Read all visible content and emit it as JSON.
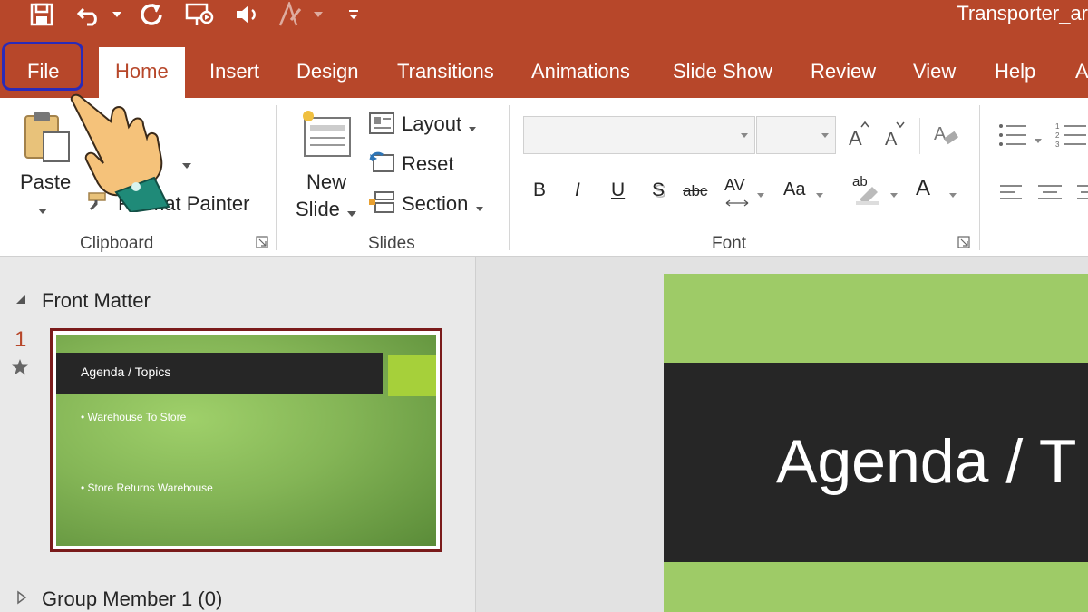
{
  "title_bar": {
    "document_title": "Transporter_ar"
  },
  "quick_access": [
    "save-icon",
    "undo-icon",
    "redo-icon",
    "present-icon",
    "speaker-icon",
    "format-icon",
    "customize-icon"
  ],
  "tabs": [
    "File",
    "Home",
    "Insert",
    "Design",
    "Transitions",
    "Animations",
    "Slide Show",
    "Review",
    "View",
    "Help",
    "A"
  ],
  "active_tab": "Home",
  "ribbon": {
    "clipboard": {
      "paste": "Paste",
      "format_painter": "Format Painter",
      "group_label": "Clipboard"
    },
    "slides": {
      "new_slide_1": "New",
      "new_slide_2": "Slide",
      "layout": "Layout",
      "reset": "Reset",
      "section": "Section",
      "group_label": "Slides"
    },
    "font": {
      "group_label": "Font",
      "font_name_value": "",
      "font_size_value": "",
      "bold": "B",
      "italic": "I",
      "underline": "U",
      "shadow": "S",
      "strike": "abc",
      "spacing": "AV",
      "case": "Aa",
      "highlight": "ab",
      "color": "A"
    }
  },
  "left_panel": {
    "section_1": "Front Matter",
    "slide_number": "1",
    "thumb_title": "Agenda / Topics",
    "thumb_bullets": [
      "• Warehouse To Store",
      "• Store Returns Warehouse"
    ],
    "section_2": "Group Member 1 (0)"
  },
  "main_slide": {
    "title": "Agenda / T"
  },
  "colors": {
    "accent": "#b7472a",
    "highlight": "#2a2ab8",
    "slide_green": "#9ecb67",
    "slide_dark": "#262626"
  }
}
